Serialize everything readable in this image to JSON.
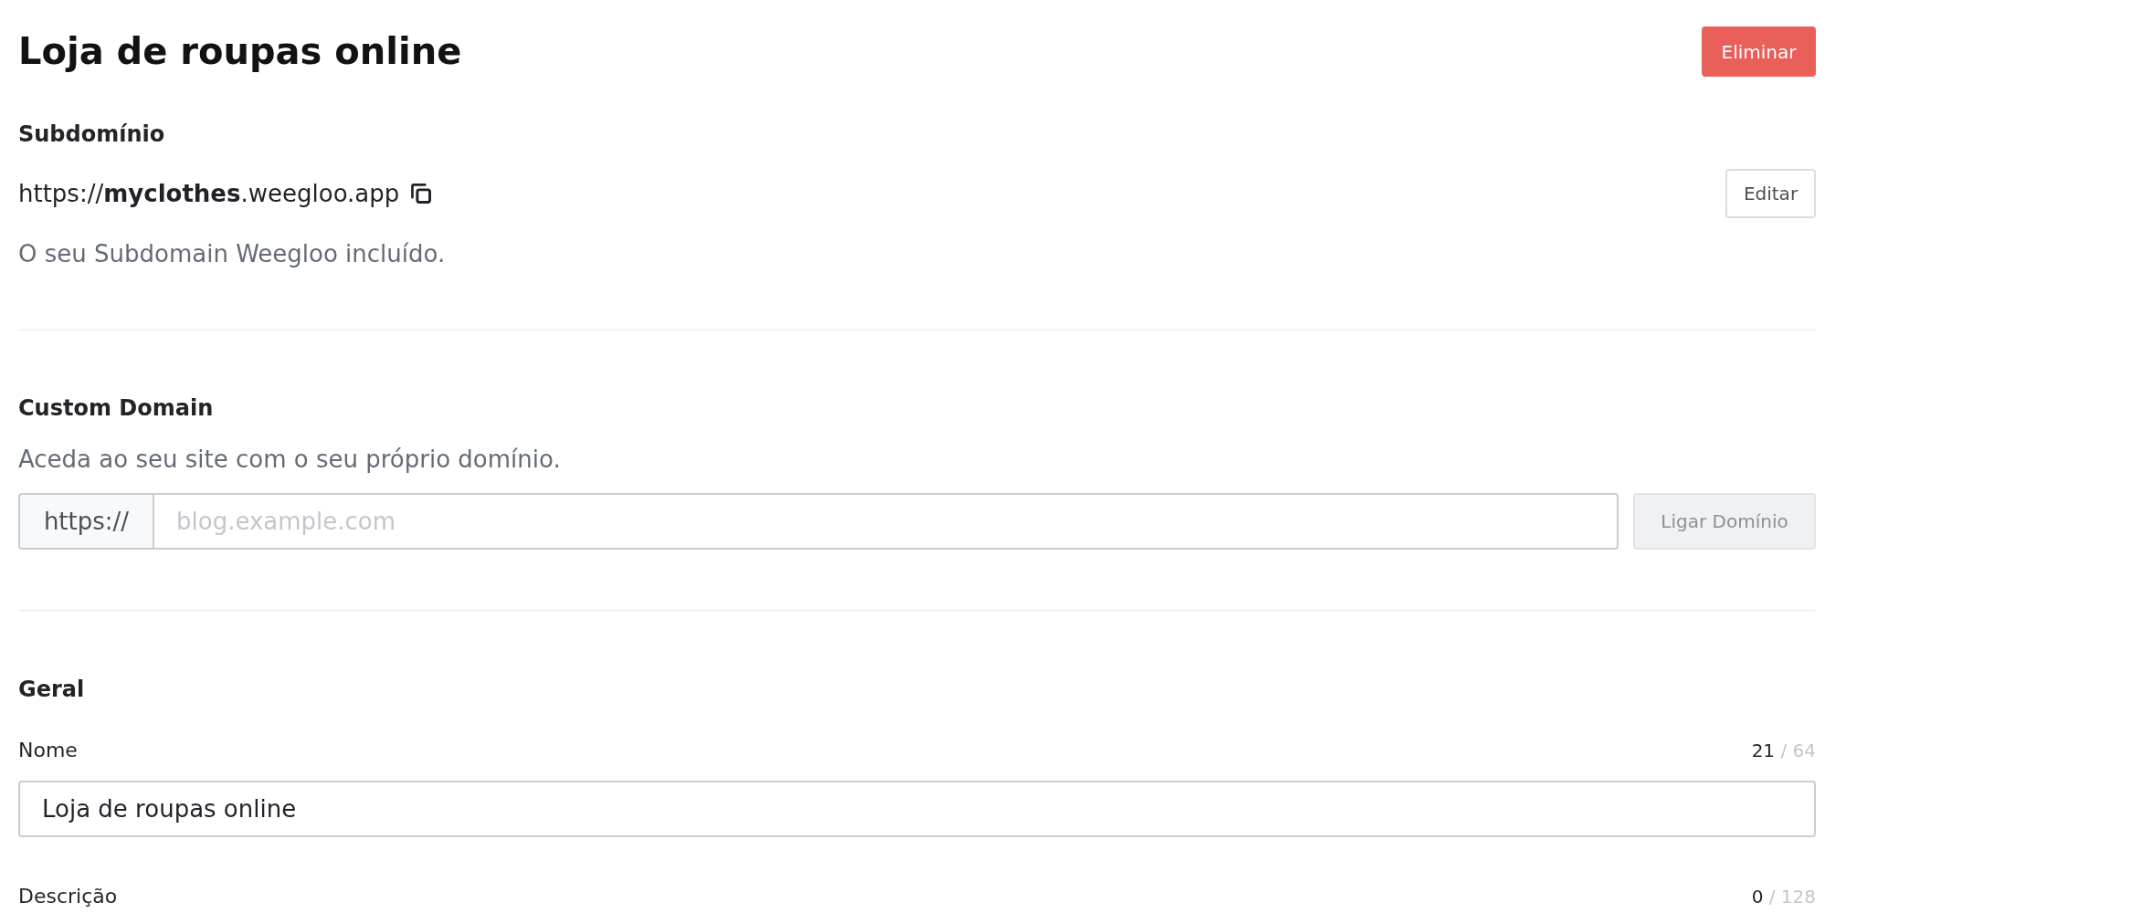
{
  "header": {
    "title": "Loja de roupas online",
    "delete_button": "Eliminar"
  },
  "subdomain": {
    "heading": "Subdomínio",
    "url": "https://**myclothes**.weegloo.app",
    "edit_button": "Editar",
    "hint": "O seu Subdomain Weegloo incluído."
  },
  "custom_domain": {
    "heading": "Custom Domain",
    "hint": "Aceda ao seu site com o seu próprio domínio.",
    "prefix": "https://",
    "placeholder": "blog.example.com",
    "connect_button": {
      "label": "Ligar Domínio",
      "disabled": true
    }
  },
  "general": {
    "heading": "Geral",
    "fields": [
      {
        "label": "Nome",
        "count": "21",
        "limit": "/ 64",
        "value": "Loja de roupas online"
      },
      {
        "label": "Descrição",
        "count": "0",
        "limit": "/ 128"
      }
    ]
  }
}
